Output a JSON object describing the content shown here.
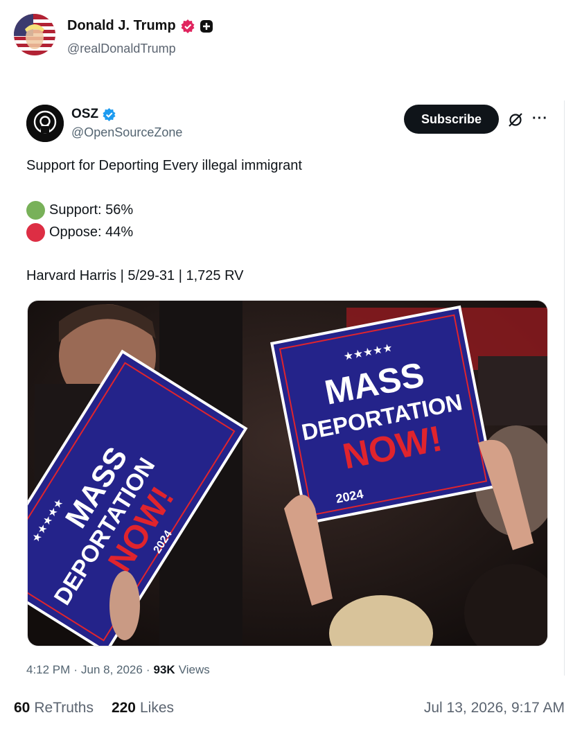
{
  "outer_post": {
    "display_name": "Donald J. Trump",
    "handle": "@realDonaldTrump",
    "retruths_count": "60",
    "retruths_label": "ReTruths",
    "likes_count": "220",
    "likes_label": "Likes",
    "posted_at": "Jul 13, 2026, 9:17 AM"
  },
  "embedded_tweet": {
    "display_name": "OSZ",
    "handle": "@OpenSourceZone",
    "subscribe_label": "Subscribe",
    "more_label": "···",
    "lines": {
      "headline": "Support for Deporting Every illegal immigrant",
      "support": "Support: 56%",
      "oppose": "Oppose: 44%",
      "source": "Harvard Harris | 5/29-31 | 1,725 RV"
    },
    "image_signs": {
      "stars": "★★★★★",
      "line1": "MASS",
      "line2": "DEPORTATION",
      "line3": "NOW!",
      "year": "2024"
    },
    "meta": {
      "time": "4:12 PM",
      "date": "Jun 8, 2026",
      "views_count": "93K",
      "views_label": "Views",
      "separator": "·"
    }
  },
  "colors": {
    "support_dot": "#78b159",
    "oppose_dot": "#dd2e44",
    "verified_pink": "#e0245e",
    "verified_blue": "#1d9bf0",
    "sign_blue": "#24238a",
    "sign_red": "#e0242d"
  },
  "icons": {
    "outer_verified": "verified-badge-icon",
    "outer_plus": "plus-badge-icon",
    "inner_verified": "blue-check-icon",
    "grok": "grok-icon",
    "more": "more-options-icon"
  }
}
